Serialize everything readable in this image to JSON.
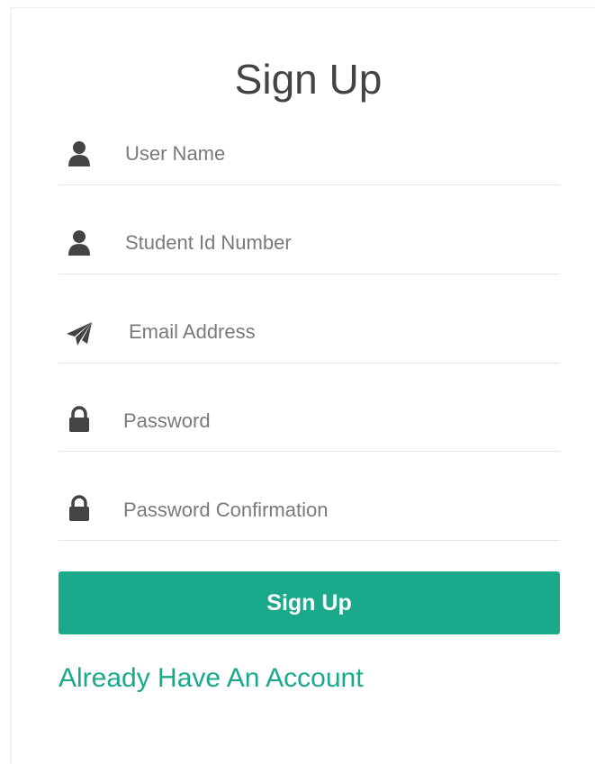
{
  "form": {
    "title": "Sign Up",
    "fields": [
      {
        "name": "user-name",
        "icon": "user-icon",
        "placeholder": "User Name",
        "value": ""
      },
      {
        "name": "student-id",
        "icon": "user-icon",
        "placeholder": "Student Id Number",
        "value": ""
      },
      {
        "name": "email",
        "icon": "paper-plane-icon",
        "placeholder": "Email Address",
        "value": ""
      },
      {
        "name": "password",
        "icon": "lock-icon",
        "placeholder": "Password",
        "value": ""
      },
      {
        "name": "password-confirmation",
        "icon": "lock-icon",
        "placeholder": "Password Confirmation",
        "value": ""
      }
    ],
    "submit_label": "Sign Up",
    "login_link": "Already Have An Account"
  },
  "colors": {
    "accent": "#1aa98a",
    "icon": "#444444",
    "title": "#444444"
  }
}
